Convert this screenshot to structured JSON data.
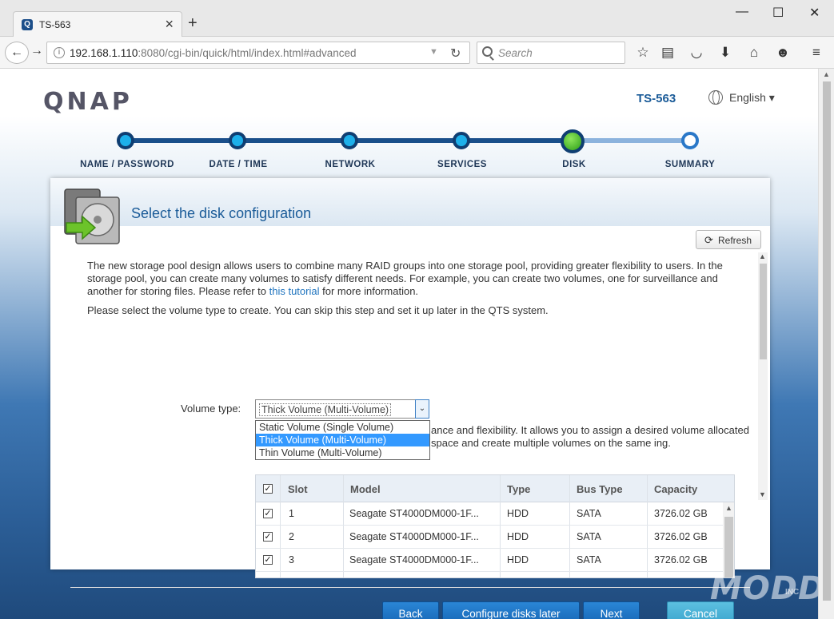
{
  "browser": {
    "tab_title": "TS-563",
    "tab_favicon": "Q",
    "url_host": "192.168.1.110",
    "url_rest": ":8080/cgi-bin/quick/html/index.html#advanced",
    "search_placeholder": "Search"
  },
  "header": {
    "logo": "QNAP",
    "model": "TS-563",
    "language": "English ▾"
  },
  "steps": [
    {
      "label": "NAME / PASSWORD",
      "state": "done"
    },
    {
      "label": "DATE / TIME",
      "state": "done"
    },
    {
      "label": "NETWORK",
      "state": "done"
    },
    {
      "label": "SERVICES",
      "state": "done"
    },
    {
      "label": "DISK",
      "state": "active"
    },
    {
      "label": "SUMMARY",
      "state": "pending"
    }
  ],
  "dialog": {
    "title": "Select the disk configuration",
    "refresh_label": "Refresh",
    "desc_part1": "The new storage pool design allows users to combine many RAID groups into one storage pool, providing greater flexibility to users. In the storage pool, you can create many volumes to satisfy different needs. For example, you can create two volumes, one for surveillance and another for storing files. Please refer to ",
    "desc_link": "this tutorial",
    "desc_part2": " for more information.",
    "desc2": "Please select the volume type to create. You can skip this step and set it up later in the QTS system.",
    "volume_type_label": "Volume type:",
    "volume_type_value": "Thick Volume (Multi-Volume)",
    "volume_options": [
      "Static Volume (Single Volume)",
      "Thick Volume (Multi-Volume)",
      "Thin Volume (Multi-Volume)"
    ],
    "volume_desc": "ance and flexibility. It allows you to assign a desired volume allocated space and create multiple volumes on the same ing."
  },
  "table": {
    "headers": {
      "slot": "Slot",
      "model": "Model",
      "type": "Type",
      "bus": "Bus Type",
      "capacity": "Capacity"
    },
    "rows": [
      {
        "slot": "1",
        "model": "Seagate ST4000DM000-1F...",
        "type": "HDD",
        "bus": "SATA",
        "capacity": "3726.02 GB"
      },
      {
        "slot": "2",
        "model": "Seagate ST4000DM000-1F...",
        "type": "HDD",
        "bus": "SATA",
        "capacity": "3726.02 GB"
      },
      {
        "slot": "3",
        "model": "Seagate ST4000DM000-1F...",
        "type": "HDD",
        "bus": "SATA",
        "capacity": "3726.02 GB"
      }
    ]
  },
  "buttons": {
    "back": "Back",
    "configure_later": "Configure disks later",
    "next": "Next",
    "cancel": "Cancel"
  },
  "watermark": {
    "main": "MODDERS",
    "sub": "INC"
  },
  "colors": {
    "accent": "#1665b4",
    "title": "#1a5b98",
    "active_step": "#2c9e18",
    "cancel": "#3aa3cc"
  }
}
